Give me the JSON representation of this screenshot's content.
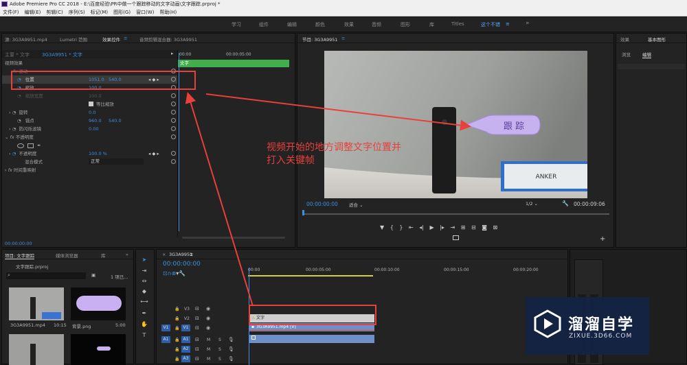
{
  "window": {
    "title": "Adobe Premiere Pro CC 2018 - E:\\百度经验\\PR中做一个跟踪移动的文字动画\\文字跟踪.prproj *"
  },
  "menu": [
    "文件(F)",
    "编辑(E)",
    "剪辑(C)",
    "序列(S)",
    "标记(M)",
    "图形(G)",
    "窗口(W)",
    "帮助(H)"
  ],
  "workspaces": {
    "items": [
      "学习",
      "组件",
      "编辑",
      "颜色",
      "效果",
      "音频",
      "图形",
      "库",
      "Titles"
    ],
    "active": "这个不错",
    "more": "»"
  },
  "source_panel": {
    "tabs": [
      "源: 3G3A9951.mp4",
      "Lumetri 范围",
      "效果控件",
      "音频剪辑混合器: 3G3A9951"
    ],
    "menu_icon": "≡",
    "clip_header": "主要 * 文字",
    "clip_name": "3G3A9951 * 文字",
    "timecodes": [
      "00:00",
      "00:00:05:00"
    ],
    "clip_bar": "文字",
    "section": "视频效果",
    "rows": {
      "motion": "运动",
      "position": {
        "label": "位置",
        "x": "1051.0",
        "y": "540.0"
      },
      "scale": {
        "label": "缩放",
        "value": "100.0"
      },
      "scale_width": {
        "label": "缩放宽度",
        "value": "100.0"
      },
      "uniform": "等比缩放",
      "rotation": {
        "label": "旋转",
        "value": "0.0"
      },
      "anchor": {
        "label": "锚点",
        "x": "960.0",
        "y": "540.0"
      },
      "antiflicker": {
        "label": "防闪烁滤镜",
        "value": "0.00"
      },
      "opacity_fx": "不透明度",
      "opacity": {
        "label": "不透明度",
        "value": "100.0 %"
      },
      "blend": {
        "label": "混合模式",
        "value": "正常"
      },
      "remap": "时间重映射"
    },
    "bottom_tc": "00:00:00:00"
  },
  "program": {
    "title": "节目: 3G3A9951",
    "timecode": "00:00:00:00",
    "fit": "适合",
    "quality": "1/2",
    "duration": "00:00:09:06",
    "overlay_text": "跟 踪",
    "product_logo": "ANKER",
    "add": "+"
  },
  "annotation": {
    "line1": "视频开始的地方调整文字位置并",
    "line2": "打入关键帧",
    "color": "#e8403a"
  },
  "right_panel": {
    "tabs": [
      "效果",
      "基本图形"
    ],
    "subtabs": [
      "浏览",
      "编辑"
    ]
  },
  "project": {
    "tabs": [
      "项目: 文字跟踪",
      "媒体浏览器",
      "库"
    ],
    "file": "文字跟踪.prproj",
    "count": "1 项已...",
    "thumbs": [
      {
        "name": "3G3A9951.mp4",
        "dur": "10:15"
      },
      {
        "name": "背景.png",
        "dur": "5:00"
      }
    ]
  },
  "timeline": {
    "title": "3G3A9951",
    "timecode": "00:00:00:00",
    "ruler": [
      "00:00",
      "00:00:05:00",
      "00:00:10:00",
      "00:00:15:00",
      "00:00:20:00"
    ],
    "tracks": [
      "V3",
      "V2",
      "V1",
      "A1",
      "A2",
      "A3"
    ],
    "src": [
      "V1",
      "A1"
    ],
    "clips": {
      "v2": "文字",
      "v1": "3G3A9951.mp4 [V]"
    },
    "track_buttons": {
      "m": "M",
      "s": "S"
    }
  },
  "watermark": {
    "title": "溜溜自学",
    "url": "ZIXUE.3D66.COM"
  },
  "colors": {
    "accent": "#3c8fdd",
    "clip_green": "#3fae4b",
    "highlight_red": "#e8403a",
    "clip_v2": "#cfcfcf",
    "clip_v1": "#6e8fc7"
  }
}
